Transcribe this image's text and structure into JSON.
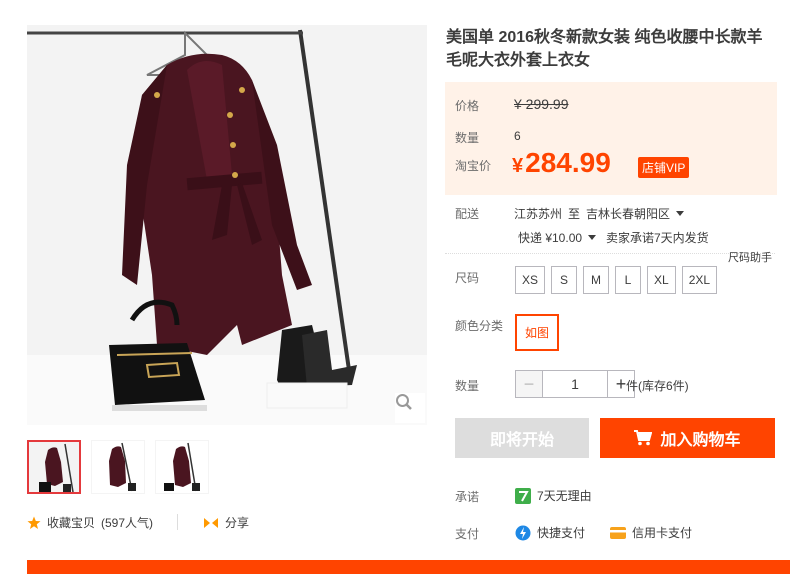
{
  "gallery": {
    "zoom_icon": "magnifier-icon",
    "thumbnails": [
      "thumb-1",
      "thumb-2",
      "thumb-3"
    ],
    "active_index": 0
  },
  "actions": {
    "favorite_label": "收藏宝贝",
    "favorite_count": "(597人气)",
    "share_label": "分享"
  },
  "product": {
    "title": "美国单 2016秋冬新款女装 纯色收腰中长款羊毛呢大衣外套上衣女"
  },
  "price": {
    "price_label": "价格",
    "original_price": "¥ 299.99",
    "qty_label": "数量",
    "qty_value": "6",
    "tb_label": "淘宝价",
    "tb_currency": "¥",
    "tb_price": "284.99",
    "vip_badge": "店铺VIP"
  },
  "shipping": {
    "label": "配送",
    "from": "江苏苏州",
    "to_word": "至",
    "to": "吉林长春朝阳区",
    "cost": "快递 ¥10.00",
    "promise": "卖家承诺7天内发货",
    "size_helper": "尺码助手"
  },
  "size": {
    "label": "尺码",
    "options": [
      "XS",
      "S",
      "M",
      "L",
      "XL",
      "2XL"
    ]
  },
  "color": {
    "label": "颜色分类",
    "selected": "如图"
  },
  "quantity": {
    "label": "数量",
    "value": "1",
    "minus": "−",
    "plus": "+",
    "stock": "件(库存6件)"
  },
  "buttons": {
    "soon": "即将开始",
    "cart": "加入购物车"
  },
  "service": {
    "promise_label": "承诺",
    "promise_item": "7天无理由",
    "pay_label": "支付",
    "pay_quick": "快捷支付",
    "pay_credit": "信用卡支付"
  },
  "colors": {
    "accent": "#ff4400",
    "price_bg": "#fff2e8",
    "coat": "#4a1520"
  }
}
